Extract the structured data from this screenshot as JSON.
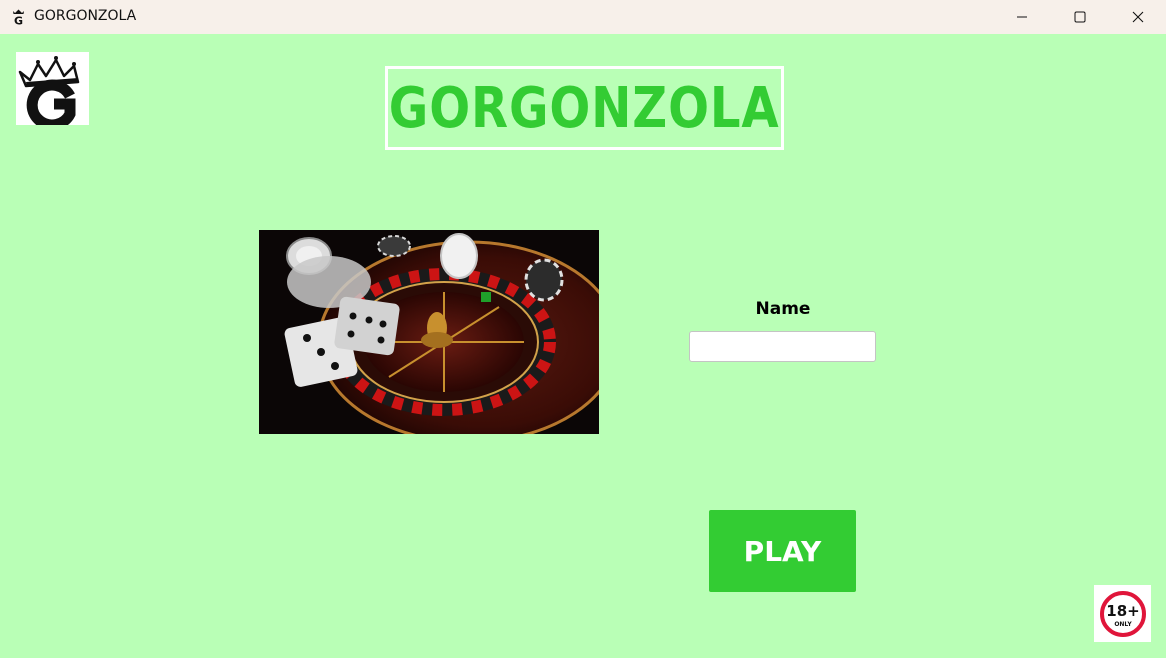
{
  "window": {
    "title": "GORGONZOLA",
    "icons": {
      "app": "gorgonzola-app-icon",
      "minimize": "minimize-icon",
      "maximize": "maximize-icon",
      "close": "close-icon"
    }
  },
  "main": {
    "logo_icon": "crown-g-logo",
    "banner_title": "GORGONZOLA",
    "hero_image": "roulette-wheel-dice-chips-image",
    "name_label": "Name",
    "name_value": "",
    "name_placeholder": "",
    "play_label": "PLAY",
    "age_badge": {
      "number": "18+",
      "text": "ONLY"
    }
  },
  "colors": {
    "background": "#b9ffb6",
    "accent": "#33cc33",
    "titlebar": "#f7f0ea",
    "badge_ring": "#e0153a"
  }
}
